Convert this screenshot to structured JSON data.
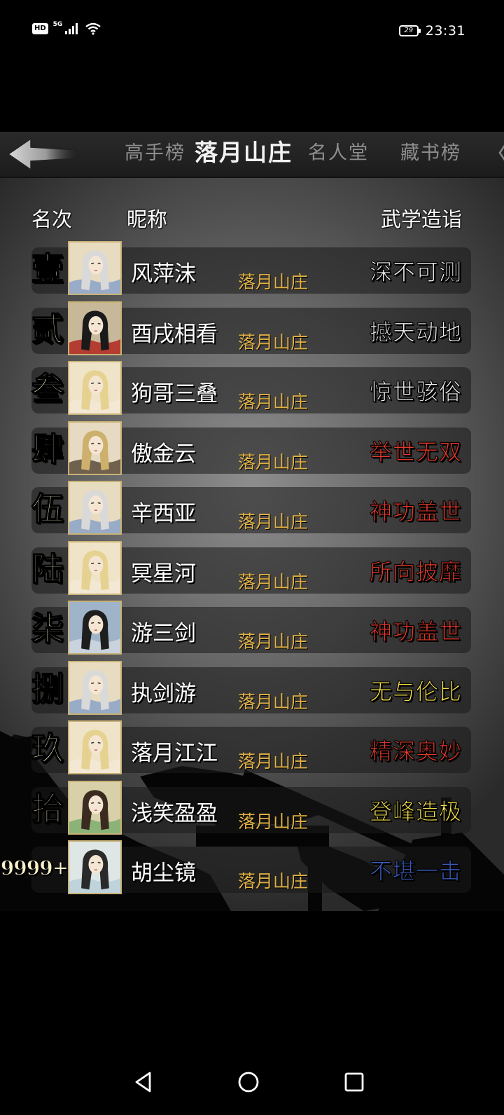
{
  "status_bar": {
    "hd": "HD",
    "network": "5G",
    "battery": "29",
    "time": "23:31"
  },
  "tabs": [
    {
      "label": "高手榜",
      "active": false
    },
    {
      "label": "落月山庄",
      "active": true
    },
    {
      "label": "名人堂",
      "active": false
    },
    {
      "label": "藏书榜",
      "active": false
    }
  ],
  "table_headers": {
    "rank": "名次",
    "nickname": "昵称",
    "skill": "武学造诣"
  },
  "rankings": [
    {
      "rank": "壹",
      "nickname": "风萍沫",
      "guild": "落月山庄",
      "skill": "深不可测",
      "skill_color": "#f2f2f2",
      "avatar_icon": "female-hero-portrait-icon"
    },
    {
      "rank": "贰",
      "nickname": "酉戌相看",
      "guild": "落月山庄",
      "skill": "撼天动地",
      "skill_color": "#eeeeee",
      "avatar_icon": "red-warrior-portrait-icon"
    },
    {
      "rank": "叁",
      "nickname": "狗哥三叠",
      "guild": "落月山庄",
      "skill": "惊世骇俗",
      "skill_color": "#eeeeee",
      "avatar_icon": "blonde-female-portrait-icon"
    },
    {
      "rank": "肆",
      "nickname": "傲金云",
      "guild": "落月山庄",
      "skill": "举世无双",
      "skill_color": "#e43a2a",
      "avatar_icon": "male-swordsman-portrait-icon"
    },
    {
      "rank": "伍",
      "nickname": "辛西亚",
      "guild": "落月山庄",
      "skill": "神功盖世",
      "skill_color": "#e43a2a",
      "avatar_icon": "female-hero-portrait-icon"
    },
    {
      "rank": "陆",
      "nickname": "冥星河",
      "guild": "落月山庄",
      "skill": "所向披靡",
      "skill_color": "#e43a2a",
      "avatar_icon": "blonde-female-portrait-icon"
    },
    {
      "rank": "柒",
      "nickname": "游三剑",
      "guild": "落月山庄",
      "skill": "神功盖世",
      "skill_color": "#e43a2a",
      "avatar_icon": "drinking-swordsman-portrait-icon"
    },
    {
      "rank": "捌",
      "nickname": "执剑游",
      "guild": "落月山庄",
      "skill": "无与伦比",
      "skill_color": "#f4e04a",
      "avatar_icon": "female-hero-portrait-icon"
    },
    {
      "rank": "玖",
      "nickname": "落月江江",
      "guild": "落月山庄",
      "skill": "精深奥妙",
      "skill_color": "#e43a2a",
      "avatar_icon": "blonde-female-portrait-icon"
    },
    {
      "rank": "拾",
      "nickname": "浅笑盈盈",
      "guild": "落月山庄",
      "skill": "登峰造极",
      "skill_color": "#f4e04a",
      "avatar_icon": "bamboo-maiden-portrait-icon"
    },
    {
      "rank": "9999+",
      "nickname": "胡尘镜",
      "guild": "落月山庄",
      "skill": "不堪一击",
      "skill_color": "#3a5bb8",
      "avatar_icon": "white-robed-scholar-portrait-icon"
    }
  ],
  "colors": {
    "guild": "#e2b246",
    "rank_numeral": "#f7f0c8",
    "avatar_border": "#c8b276"
  }
}
